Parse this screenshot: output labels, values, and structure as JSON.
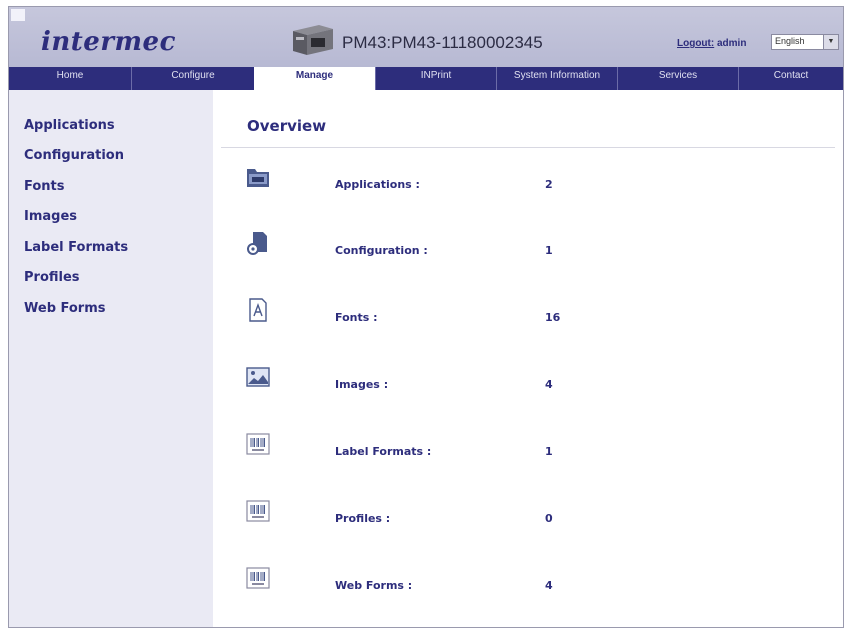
{
  "header": {
    "logo_text": "intermec",
    "device_name": "PM43:PM43-11180002345",
    "logout_label": "Logout:",
    "user": "admin",
    "language": "English"
  },
  "nav": {
    "tabs": [
      {
        "label": "Home"
      },
      {
        "label": "Configure"
      },
      {
        "label": "Manage",
        "active": true
      },
      {
        "label": "INPrint"
      },
      {
        "label": "System Information"
      },
      {
        "label": "Services"
      },
      {
        "label": "Contact"
      }
    ]
  },
  "sidebar": {
    "items": [
      {
        "label": "Applications"
      },
      {
        "label": "Configuration"
      },
      {
        "label": "Fonts"
      },
      {
        "label": "Images"
      },
      {
        "label": "Label Formats"
      },
      {
        "label": "Profiles"
      },
      {
        "label": "Web Forms"
      }
    ]
  },
  "main": {
    "title": "Overview",
    "rows": [
      {
        "icon": "folder-icon",
        "label": "Applications :",
        "count": "2"
      },
      {
        "icon": "configuration-file-icon",
        "label": "Configuration :",
        "count": "1"
      },
      {
        "icon": "font-file-icon",
        "label": "Fonts :",
        "count": "16"
      },
      {
        "icon": "image-icon",
        "label": "Images :",
        "count": "4"
      },
      {
        "icon": "barcode-label-icon",
        "label": "Label Formats :",
        "count": "1"
      },
      {
        "icon": "barcode-label-icon",
        "label": "Profiles :",
        "count": "0"
      },
      {
        "icon": "barcode-label-icon",
        "label": "Web Forms :",
        "count": "4"
      }
    ]
  },
  "colors": {
    "brand": "#2d2d7c",
    "header_bg": "#bdbfd8",
    "sidebar_bg": "#eaeaf4"
  }
}
